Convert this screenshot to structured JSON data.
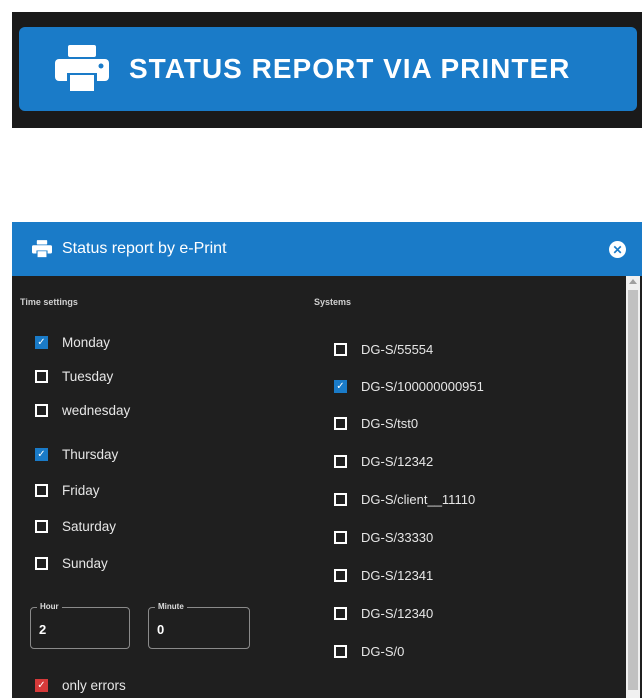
{
  "banner": {
    "label": "STATUS REPORT VIA PRINTER",
    "icon": "printer-icon",
    "color": "#1a7bc8"
  },
  "dialog": {
    "title": "Status report by e-Print",
    "title_icon": "printer-icon",
    "close_icon": "close-icon",
    "header_color": "#1a7bc8",
    "time_settings": {
      "label": "Time settings",
      "days": [
        {
          "label": "Monday",
          "checked": true
        },
        {
          "label": "Tuesday",
          "checked": false
        },
        {
          "label": "wednesday",
          "checked": false
        },
        {
          "label": "Thursday",
          "checked": true
        },
        {
          "label": "Friday",
          "checked": false
        },
        {
          "label": "Saturday",
          "checked": false
        },
        {
          "label": "Sunday",
          "checked": false
        }
      ],
      "hour": {
        "label": "Hour",
        "value": "2"
      },
      "minute": {
        "label": "Minute",
        "value": "0"
      },
      "only_errors": {
        "label": "only errors",
        "checked": true,
        "color": "#d63a3a"
      }
    },
    "systems": {
      "label": "Systems",
      "items": [
        {
          "label": "DG-S/55554",
          "checked": false
        },
        {
          "label": "DG-S/100000000951",
          "checked": true
        },
        {
          "label": "DG-S/tst0",
          "checked": false
        },
        {
          "label": "DG-S/12342",
          "checked": false
        },
        {
          "label": "DG-S/client__11110",
          "checked": false
        },
        {
          "label": "DG-S/33330",
          "checked": false
        },
        {
          "label": "DG-S/12341",
          "checked": false
        },
        {
          "label": "DG-S/12340",
          "checked": false
        },
        {
          "label": "DG-S/0",
          "checked": false
        }
      ]
    }
  }
}
